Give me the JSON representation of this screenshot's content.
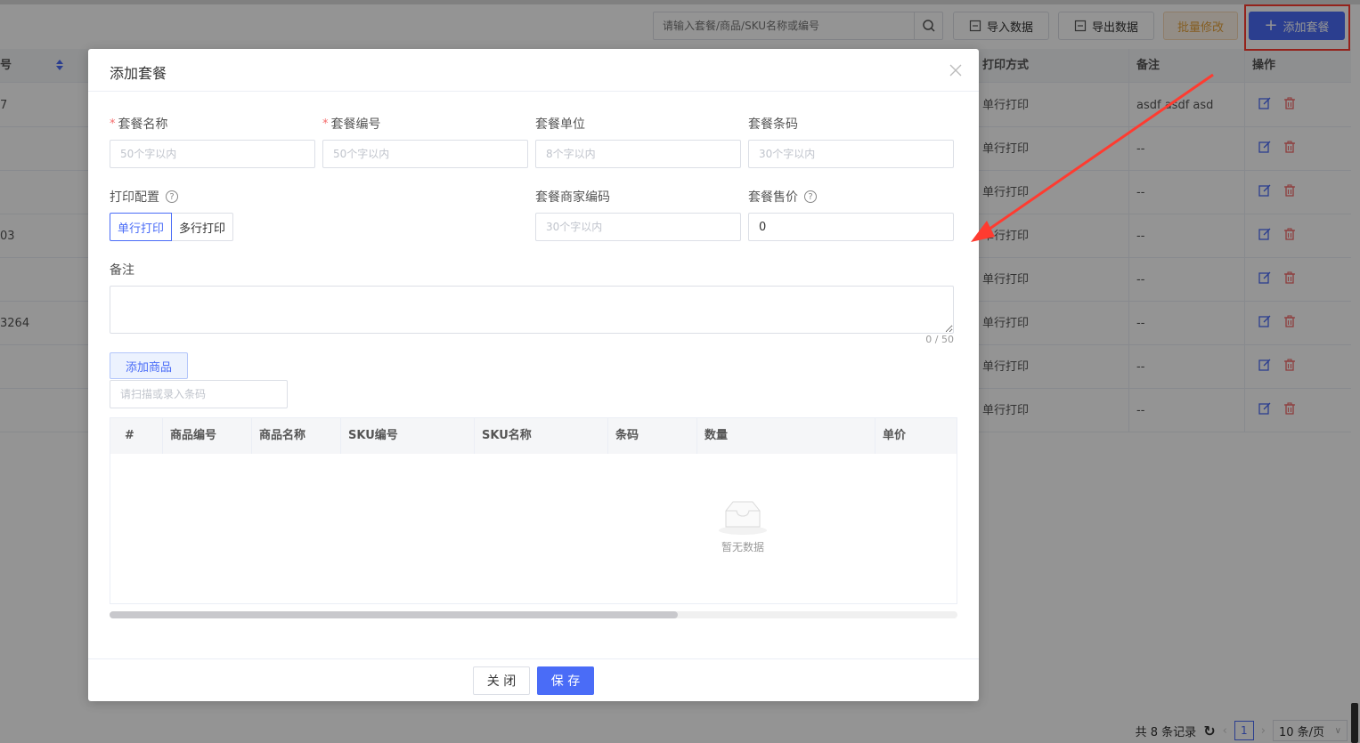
{
  "toolbar": {
    "search_placeholder": "请输入套餐/商品/SKU名称或编号",
    "import_label": "导入数据",
    "export_label": "导出数据",
    "batch_label": "批量修改",
    "add_label": "添加套餐"
  },
  "table": {
    "headers": {
      "code": "号",
      "print_mode": "打印方式",
      "remark": "备注",
      "ops": "操作"
    },
    "rows": [
      {
        "code": "7",
        "print_mode": "单行打印",
        "remark": "asdf asdf asd"
      },
      {
        "code": "",
        "print_mode": "单行打印",
        "remark": "--"
      },
      {
        "code": "",
        "print_mode": "单行打印",
        "remark": "--"
      },
      {
        "code": "03",
        "print_mode": "单行打印",
        "remark": "--"
      },
      {
        "code": "",
        "print_mode": "单行打印",
        "remark": "--"
      },
      {
        "code": "3264",
        "print_mode": "单行打印",
        "remark": "--"
      },
      {
        "code": "",
        "print_mode": "单行打印",
        "remark": "--"
      },
      {
        "code": "",
        "print_mode": "单行打印",
        "remark": "--"
      }
    ]
  },
  "pager": {
    "total": "共 8 条记录",
    "current": "1",
    "page_size": "10 条/页"
  },
  "modal": {
    "title": "添加套餐",
    "fields": {
      "name_label": "套餐名称",
      "name_placeholder": "50个字以内",
      "code_label": "套餐编号",
      "code_placeholder": "50个字以内",
      "unit_label": "套餐单位",
      "unit_placeholder": "8个字以内",
      "barcode_label": "套餐条码",
      "barcode_placeholder": "30个字以内",
      "print_config_label": "打印配置",
      "print_single": "单行打印",
      "print_multi": "多行打印",
      "merchant_code_label": "套餐商家编码",
      "merchant_code_placeholder": "30个字以内",
      "price_label": "套餐售价",
      "price_value": "0",
      "remark_label": "备注",
      "remark_counter": "0 / 50"
    },
    "add_goods_label": "添加商品",
    "scan_placeholder": "请扫描或录入条码",
    "goods_table": {
      "headers": [
        "#",
        "商品编号",
        "商品名称",
        "SKU编号",
        "SKU名称",
        "条码",
        "数量",
        "单价"
      ],
      "empty_text": "暂无数据"
    },
    "footer": {
      "close_label": "关 闭",
      "save_label": "保 存"
    }
  },
  "colors": {
    "primary": "#4a6cf7",
    "danger": "#f56c6c",
    "warning": "#e6a23c",
    "annotation": "#ff3b30"
  }
}
